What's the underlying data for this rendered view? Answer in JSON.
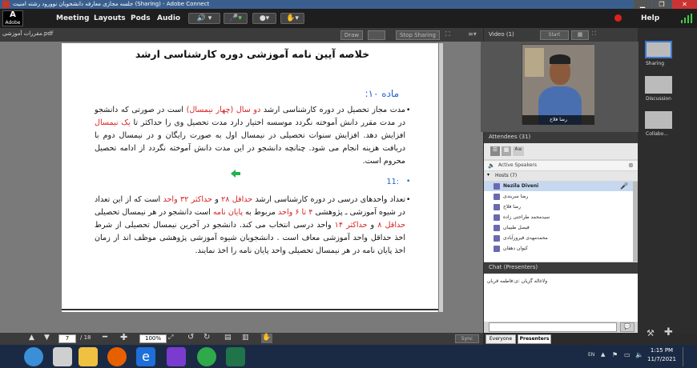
{
  "window": {
    "title": "جلسه مجازی معارفه دانشجویان نوورود رشته امنیت (Sharing) - Adobe Connect"
  },
  "menubar": {
    "logo_text": "Adobe",
    "items": [
      "Meeting",
      "Layouts",
      "Pods",
      "Audio"
    ],
    "help": "Help"
  },
  "share_pod": {
    "file_label": "pdf.مقررات آموزشی",
    "draw_label": "Draw",
    "stop_sharing_label": "Stop Sharing",
    "sync_label": "Sync",
    "page_current": "7",
    "page_total": "/ 18",
    "zoom": "100%"
  },
  "document": {
    "title": "خلاصه آیین نامه آموزشی دوره کارشناسی ارشد",
    "section1": "ماده ۱۰:",
    "bullet1_parts": [
      "مدت مجاز تحصیل در دوره کارشناسی ارشد ",
      "دو سال (چهار نیمسال)",
      " است در صورتی که دانشجو در مدت مقرر دانش آموخته نگردد موسسه اختیار دارد مدت تحصیل وی را حداکثر تا ",
      "یک نیمسال",
      " افزایش دهد. افزایش سنوات تحصیلی در نیمسال اول به صورت رایگان و در نیمسال دوم با دریافت هزینه انجام می شود. چنانچه دانشجو در این مدت دانش آموخته نگردد از ادامه تحصیل محروم است."
    ],
    "section2": ":11",
    "bullet2_parts": [
      "تعداد واحدهای درسی در دوره کارشناسی ارشد ",
      "حداقل ۲۸",
      " و ",
      "حداکثر ۳۲ واحد",
      " است که از این تعداد در شیوه آموزشی ـ پژوهشی ",
      "۴ تا ۶ واحد",
      " مربوط به ",
      "پایان نامه",
      " است دانشجو در هر نیمسال تحصیلی ",
      "حداقل ۸",
      " و ",
      "حداکثر ۱۴",
      " واحد درسی انتخاب می کند. دانشجو در آخرین نیمسال تحصیلی از شرط اخذ حداقل واحد آموزشی معاف است . دانشجویان شیوه آموزشی پژوهشی موظف اند از زمان اخذ پایان نامه در هر نیمسال تحصیلی واحد پایان نامه را اخذ نمایند."
    ]
  },
  "video_pod": {
    "title": "Video",
    "count": "(1)",
    "start_label": "Start",
    "caption": "رضا فلاح"
  },
  "attendees_pod": {
    "title": "Attendees",
    "count": "(31)",
    "active_speakers": "Active Speakers",
    "hosts_label": "Hosts (7)",
    "hosts": [
      "Nezila Diveni",
      "رضا سربندی",
      "رضا فلاح",
      "سیدمحمد طراحتی زاده",
      "فیصل طبیبان",
      "محمدمهدی فیروزآبادی",
      "کیوان دهقان"
    ]
  },
  "chat_pod": {
    "title": "Chat",
    "subtitle": "(Presenters)",
    "message": "ولاغاله گزیان :ی:فاطمه قربان",
    "tab_everyone": "Everyone",
    "tab_presenters": "Presenters"
  },
  "far_right": {
    "items": [
      "Sharing",
      "Discussion",
      "Collabo..."
    ]
  },
  "taskbar": {
    "lang": "EN",
    "time": "1:15 PM",
    "date": "11/7/2021"
  },
  "colors": {
    "accent_red": "#d62020",
    "link_blue": "#1a62d0",
    "title_blue": "#3a5f8f"
  }
}
